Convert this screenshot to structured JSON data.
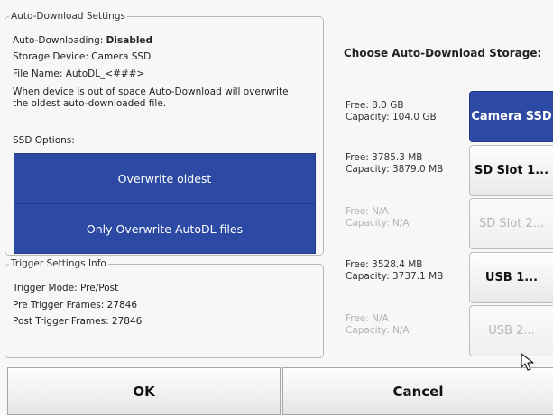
{
  "auto_download": {
    "title": "Auto-Download Settings",
    "status_label": "Auto-Downloading: ",
    "status_value": "Disabled",
    "storage_device": "Storage Device: Camera SSD",
    "file_name": "File Name: AutoDL_<###>",
    "note": "When device is out of space Auto-Download will overwrite the oldest auto-downloaded file.",
    "ssd_options_label": "SSD Options:",
    "buttons": {
      "overwrite_oldest": "Overwrite oldest",
      "only_overwrite_autodl": "Only Overwrite AutoDL files"
    }
  },
  "trigger": {
    "title": "Trigger Settings Info",
    "mode": "Trigger Mode: Pre/Post",
    "pre_frames": "Pre Trigger Frames: 27846",
    "post_frames": "Post Trigger Frames: 27846"
  },
  "storage": {
    "title": "Choose Auto-Download Storage:",
    "devices": [
      {
        "free": "Free: 8.0 GB",
        "capacity": "Capacity: 104.0 GB",
        "button": "Camera SSD",
        "state": "selected"
      },
      {
        "free": "Free: 3785.3 MB",
        "capacity": "Capacity: 3879.0 MB",
        "button": "SD Slot 1...",
        "state": "enabled"
      },
      {
        "free": "Free: N/A",
        "capacity": "Capacity: N/A",
        "button": "SD Slot 2...",
        "state": "disabled"
      },
      {
        "free": "Free: 3528.4 MB",
        "capacity": "Capacity: 3737.1 MB",
        "button": "USB 1...",
        "state": "enabled"
      },
      {
        "free": "Free: N/A",
        "capacity": "Capacity: N/A",
        "button": "USB 2...",
        "state": "disabled"
      }
    ]
  },
  "dialog": {
    "ok_label": "OK",
    "cancel_label": "Cancel"
  },
  "colors": {
    "accent_blue": "#2c4aa3",
    "disabled_text": "#b3b3b3",
    "background": "#f7f7f7"
  },
  "icons": {
    "pointer": "mouse-pointer-icon"
  }
}
